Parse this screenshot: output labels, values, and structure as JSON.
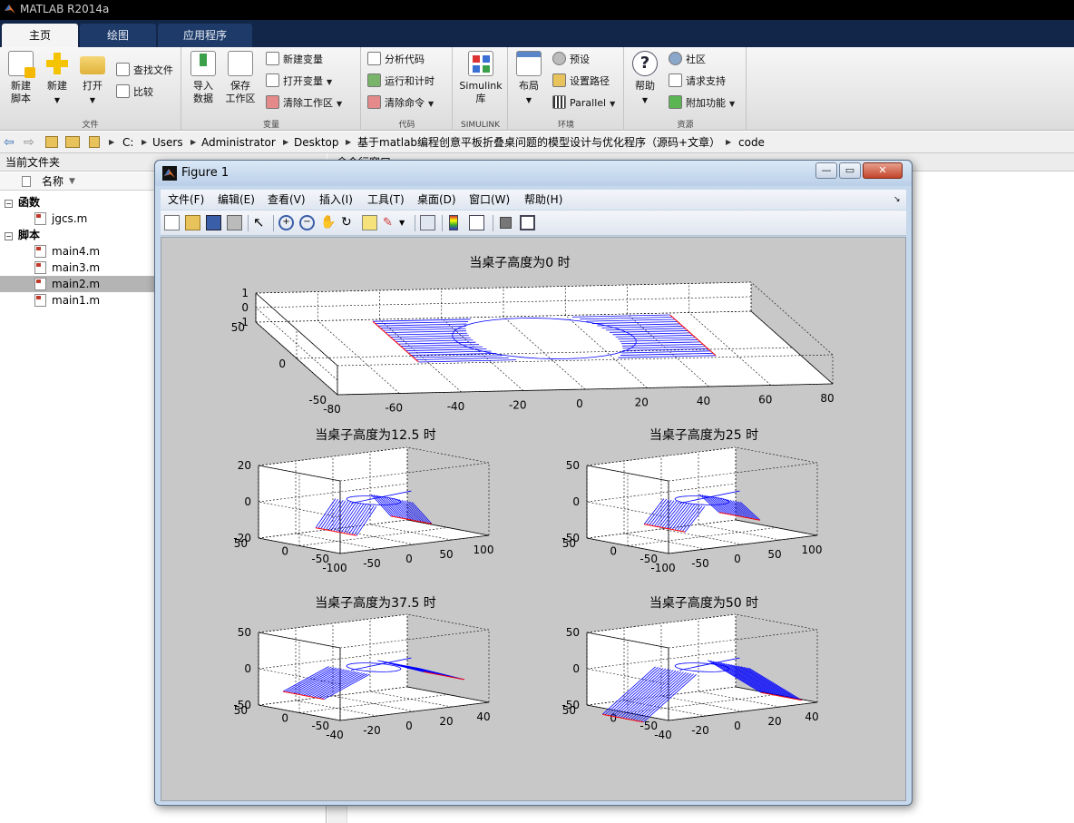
{
  "app": {
    "title": "MATLAB R2014a",
    "tabs": [
      "主页",
      "绘图",
      "应用程序"
    ],
    "active_tab": 0
  },
  "ribbon": {
    "groups": {
      "file": "文件",
      "variable": "变量",
      "code": "代码",
      "simulink": "SIMULINK",
      "environment": "环境",
      "resources": "资源"
    },
    "new_script": [
      "新建",
      "脚本"
    ],
    "new": "新建",
    "open": "打开",
    "find_files": "查找文件",
    "compare": "比较",
    "import_data": [
      "导入",
      "数据"
    ],
    "save_workspace": [
      "保存",
      "工作区"
    ],
    "new_variable": "新建变量",
    "open_variable": "打开变量",
    "clear_workspace": "清除工作区",
    "analyze_code": "分析代码",
    "run_and_time": "运行和计时",
    "clear_commands": "清除命令",
    "simulink_library": [
      "Simulink",
      "库"
    ],
    "layout": "布局",
    "preferences": "预设",
    "set_path": "设置路径",
    "parallel": "Parallel",
    "help": "帮助",
    "community": "社区",
    "request_support": "请求支持",
    "add_ons": "附加功能"
  },
  "address": {
    "crumbs": [
      "C:",
      "Users",
      "Administrator",
      "Desktop",
      "基于matlab编程创意平板折叠桌问题的模型设计与优化程序（源码+文章）",
      "code"
    ]
  },
  "left_panel": {
    "title": "当前文件夹",
    "column_name": "名称",
    "groups": [
      {
        "label": "函数",
        "files": [
          "jgcs.m"
        ]
      },
      {
        "label": "脚本",
        "files": [
          "main4.m",
          "main3.m",
          "main2.m",
          "main1.m"
        ]
      }
    ],
    "selected_file": "main2.m"
  },
  "command_panel": {
    "title": "命令行窗口"
  },
  "figure": {
    "title": "Figure 1",
    "menu": [
      "文件(F)",
      "编辑(E)",
      "查看(V)",
      "插入(I)",
      "工具(T)",
      "桌面(D)",
      "窗口(W)",
      "帮助(H)"
    ],
    "window_buttons": {
      "minimize": "—",
      "restore": "▭",
      "close": "✕"
    },
    "colors": {
      "surface_line": "#0000ff",
      "edge_line": "#ff0000",
      "canvas": "#c8c8c8"
    }
  },
  "chart_data": [
    {
      "type": "3d-surface",
      "title": "当桌子高度为0 时",
      "x_ticks": [
        -80,
        -60,
        -40,
        -20,
        0,
        20,
        40,
        60,
        80
      ],
      "y_ticks": [
        -50,
        0,
        50
      ],
      "z_ticks": [
        -1,
        0,
        1
      ],
      "xlim": [
        -80,
        80
      ],
      "ylim": [
        -50,
        50
      ],
      "zlim": [
        -1,
        1
      ],
      "grid": true
    },
    {
      "type": "3d-surface",
      "title": "当桌子高度为12.5 时",
      "x_ticks": [
        -100,
        -50,
        0,
        50,
        100
      ],
      "y_ticks": [
        -50,
        0,
        50
      ],
      "z_ticks": [
        -20,
        0,
        20
      ],
      "xlim": [
        -100,
        100
      ],
      "ylim": [
        -50,
        50
      ],
      "zlim": [
        -20,
        20
      ],
      "grid": true
    },
    {
      "type": "3d-surface",
      "title": "当桌子高度为25 时",
      "x_ticks": [
        -100,
        -50,
        0,
        50,
        100
      ],
      "y_ticks": [
        -50,
        0,
        50
      ],
      "z_ticks": [
        -50,
        0,
        50
      ],
      "xlim": [
        -100,
        100
      ],
      "ylim": [
        -50,
        50
      ],
      "zlim": [
        -50,
        50
      ],
      "grid": true
    },
    {
      "type": "3d-surface",
      "title": "当桌子高度为37.5 时",
      "x_ticks": [
        -40,
        -20,
        0,
        20,
        40
      ],
      "y_ticks": [
        -50,
        0,
        50
      ],
      "z_ticks": [
        -50,
        0,
        50
      ],
      "xlim": [
        -40,
        40
      ],
      "ylim": [
        -50,
        50
      ],
      "zlim": [
        -50,
        50
      ],
      "grid": true
    },
    {
      "type": "3d-surface",
      "title": "当桌子高度为50 时",
      "x_ticks": [
        -40,
        -20,
        0,
        20,
        40
      ],
      "y_ticks": [
        -50,
        0,
        50
      ],
      "z_ticks": [
        -50,
        0,
        50
      ],
      "xlim": [
        -40,
        40
      ],
      "ylim": [
        -50,
        50
      ],
      "zlim": [
        -50,
        50
      ],
      "grid": true
    }
  ]
}
